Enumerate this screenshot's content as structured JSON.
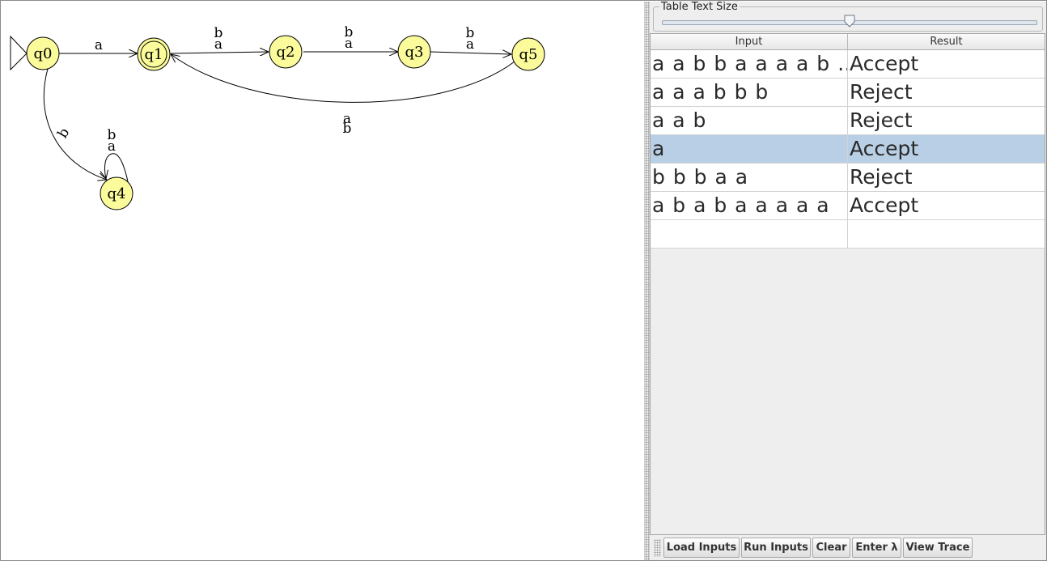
{
  "automaton": {
    "states": [
      {
        "id": "q0",
        "label": "q0",
        "initial": true,
        "final": false
      },
      {
        "id": "q1",
        "label": "q1",
        "initial": false,
        "final": true
      },
      {
        "id": "q2",
        "label": "q2",
        "initial": false,
        "final": false
      },
      {
        "id": "q3",
        "label": "q3",
        "initial": false,
        "final": false
      },
      {
        "id": "q5",
        "label": "q5",
        "initial": false,
        "final": false
      },
      {
        "id": "q4",
        "label": "q4",
        "initial": false,
        "final": false
      }
    ],
    "transitions": [
      {
        "from": "q0",
        "to": "q1",
        "labels": [
          "a"
        ]
      },
      {
        "from": "q0",
        "to": "q4",
        "labels": [
          "b"
        ]
      },
      {
        "from": "q1",
        "to": "q2",
        "labels": [
          "b",
          "a"
        ]
      },
      {
        "from": "q2",
        "to": "q3",
        "labels": [
          "b",
          "a"
        ]
      },
      {
        "from": "q3",
        "to": "q5",
        "labels": [
          "b",
          "a"
        ]
      },
      {
        "from": "q5",
        "to": "q1",
        "labels": [
          "a",
          "b"
        ]
      },
      {
        "from": "q4",
        "to": "q4",
        "labels": [
          "b",
          "a"
        ]
      }
    ],
    "state_color": "#fbfb9b"
  },
  "panel": {
    "size_label": "Table Text Size",
    "slider_level": 0.5,
    "table": {
      "headers": [
        "Input",
        "Result"
      ],
      "rows": [
        {
          "input": "a a b b a a a a b …",
          "result": "Accept",
          "selected": false
        },
        {
          "input": "a a a b b b",
          "result": "Reject",
          "selected": false
        },
        {
          "input": "a a b",
          "result": "Reject",
          "selected": false
        },
        {
          "input": "a",
          "result": "Accept",
          "selected": true
        },
        {
          "input": "b b b a a",
          "result": "Reject",
          "selected": false
        },
        {
          "input": "a b a b a a a a a",
          "result": "Accept",
          "selected": false
        },
        {
          "input": "",
          "result": "",
          "selected": false
        }
      ],
      "selected_color": "#b8cfe5"
    },
    "buttons": {
      "load": "Load Inputs",
      "run": "Run Inputs",
      "clear": "Clear",
      "lambda": "Enter λ",
      "trace": "View Trace"
    }
  }
}
